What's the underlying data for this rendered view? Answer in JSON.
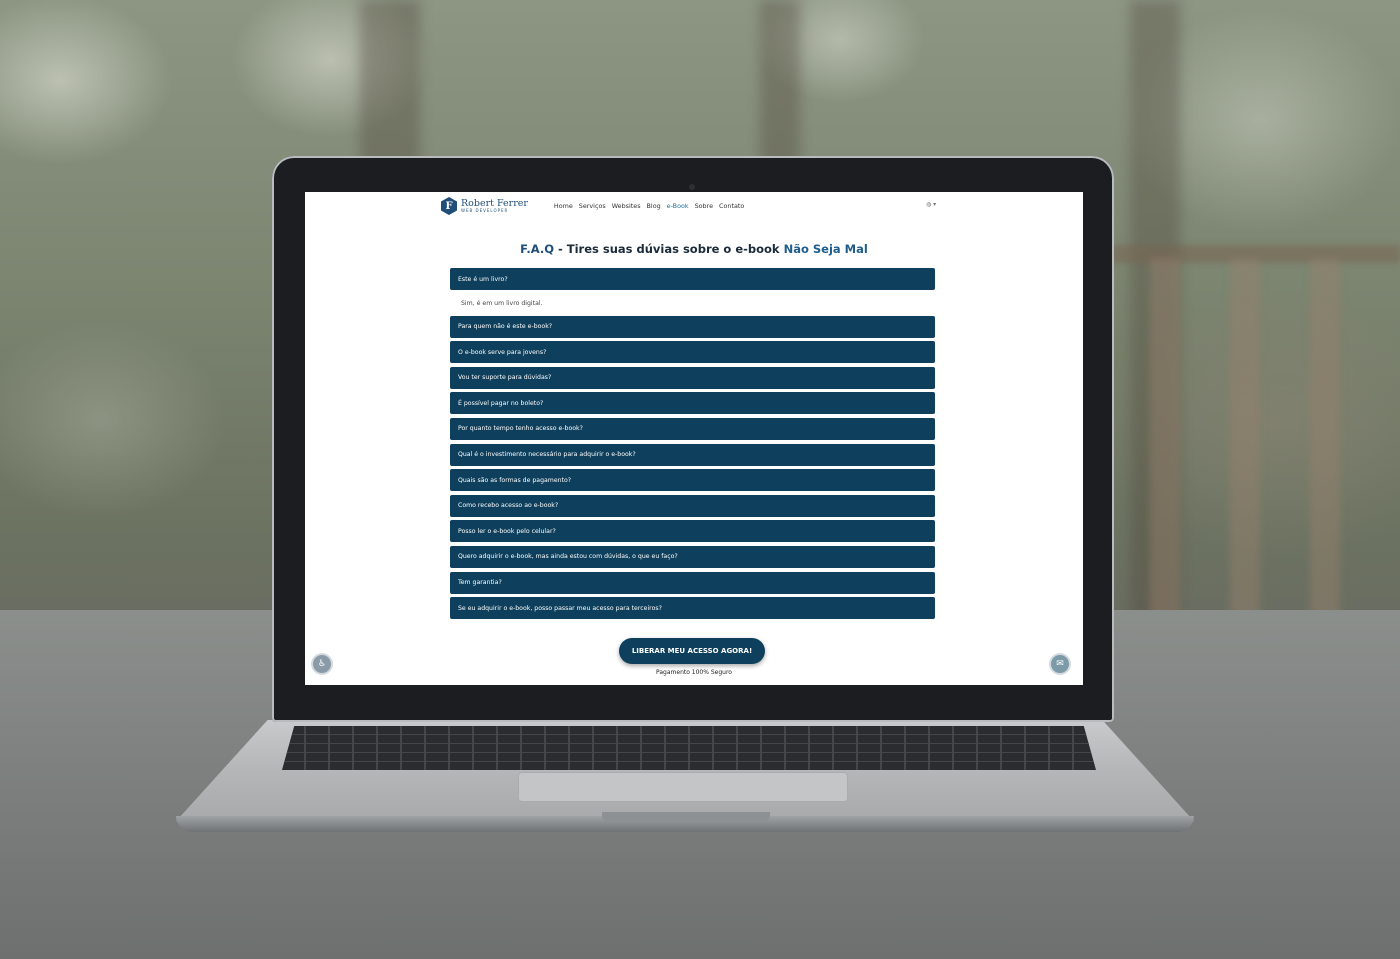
{
  "site": {
    "logo": {
      "name": "Robert Ferrer",
      "tagline": "WEB DEVELOPER",
      "initial": "F"
    },
    "nav": {
      "items": [
        {
          "label": "Home"
        },
        {
          "label": "Serviços"
        },
        {
          "label": "Websites"
        },
        {
          "label": "Blog"
        },
        {
          "label": "e-Book",
          "active": true
        },
        {
          "label": "Sobre"
        },
        {
          "label": "Contato"
        }
      ],
      "language_selector": "◍ ▾"
    }
  },
  "faq": {
    "title_prefix": "F.A.Q",
    "title_middle": " - Tires suas dúvias sobre o e-book ",
    "title_highlight": "Não Seja Mal",
    "items": [
      {
        "question": "Este é um livro?",
        "answer": "Sim, é em um livro digital.",
        "expanded": true
      },
      {
        "question": "Para quem não é este e-book?"
      },
      {
        "question": "O e-book serve para jovens?"
      },
      {
        "question": "Vou ter suporte para dúvidas?"
      },
      {
        "question": "É possível pagar no boleto?"
      },
      {
        "question": "Por quanto tempo tenho acesso e-book?"
      },
      {
        "question": "Qual é o investimento necessário para adquirir o e-book?"
      },
      {
        "question": "Quais são as formas de pagamento?"
      },
      {
        "question": "Como recebo acesso ao e-book?"
      },
      {
        "question": "Posso ler o e-book pelo celular?"
      },
      {
        "question": "Quero adquirir o e-book, mas ainda estou com dúvidas, o que eu faço?"
      },
      {
        "question": "Tem garantia?"
      },
      {
        "question": "Se eu adquirir o e-book, posso passar meu acesso para terceiros?"
      }
    ]
  },
  "cta": {
    "button_label": "LIBERAR MEU ACESSO AGORA!",
    "note": "Pagamento 100% Seguro"
  },
  "floating": {
    "left_icon": "accessibility-icon",
    "right_icon": "chat-icon"
  },
  "colors": {
    "brand": "#0e3f5c",
    "accent": "#1f4e79"
  }
}
